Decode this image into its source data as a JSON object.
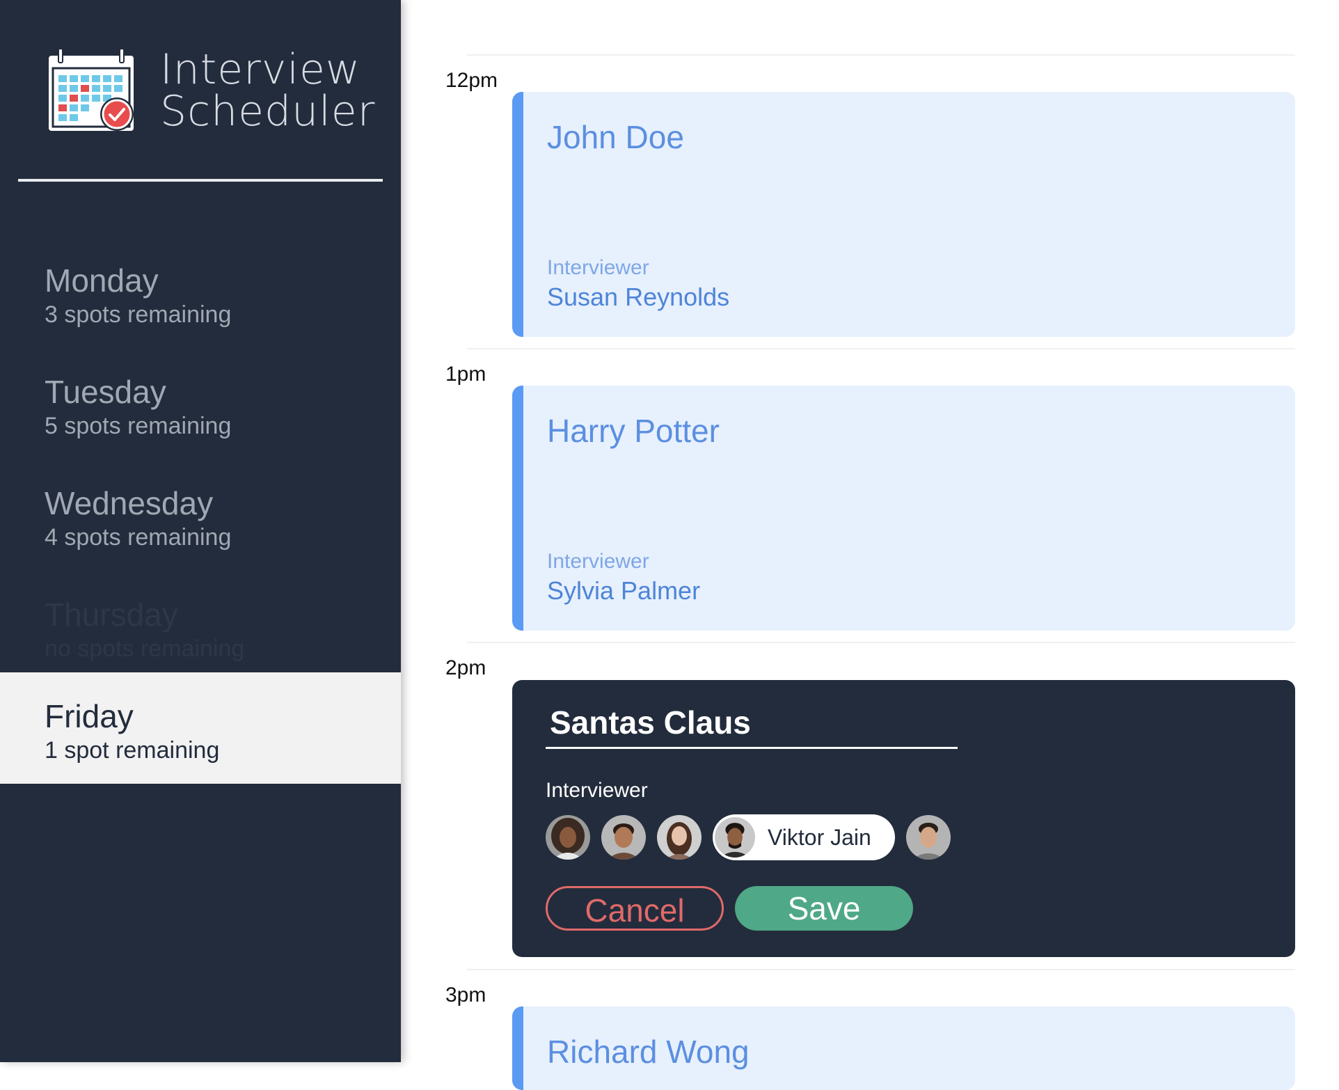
{
  "app": {
    "title_line1": "Interview",
    "title_line2": "Scheduler",
    "logo_icon": "calendar-check-icon"
  },
  "days": [
    {
      "name": "Monday",
      "spots": "3 spots remaining",
      "state": "normal"
    },
    {
      "name": "Tuesday",
      "spots": "5 spots remaining",
      "state": "normal"
    },
    {
      "name": "Wednesday",
      "spots": "4 spots remaining",
      "state": "normal"
    },
    {
      "name": "Thursday",
      "spots": "no spots remaining",
      "state": "full"
    },
    {
      "name": "Friday",
      "spots": "1 spot remaining",
      "state": "selected"
    }
  ],
  "schedule": {
    "times": [
      "12pm",
      "1pm",
      "2pm",
      "3pm"
    ],
    "appointments": [
      {
        "student": "John Doe",
        "interviewer_label": "Interviewer",
        "interviewer": "Susan Reynolds"
      },
      {
        "student": "Harry Potter",
        "interviewer_label": "Interviewer",
        "interviewer": "Sylvia Palmer"
      },
      {
        "student": "Richard Wong"
      }
    ]
  },
  "form": {
    "student_value": "Santas Claus",
    "interviewer_label": "Interviewer",
    "selected_interviewer": "Viktor Jain",
    "cancel_label": "Cancel",
    "save_label": "Save"
  },
  "colors": {
    "sidebar_bg": "#232c3c",
    "card_bg": "#e7f0fd",
    "accent": "#5b9af3",
    "danger": "#e06a6a",
    "success": "#4fa887"
  }
}
